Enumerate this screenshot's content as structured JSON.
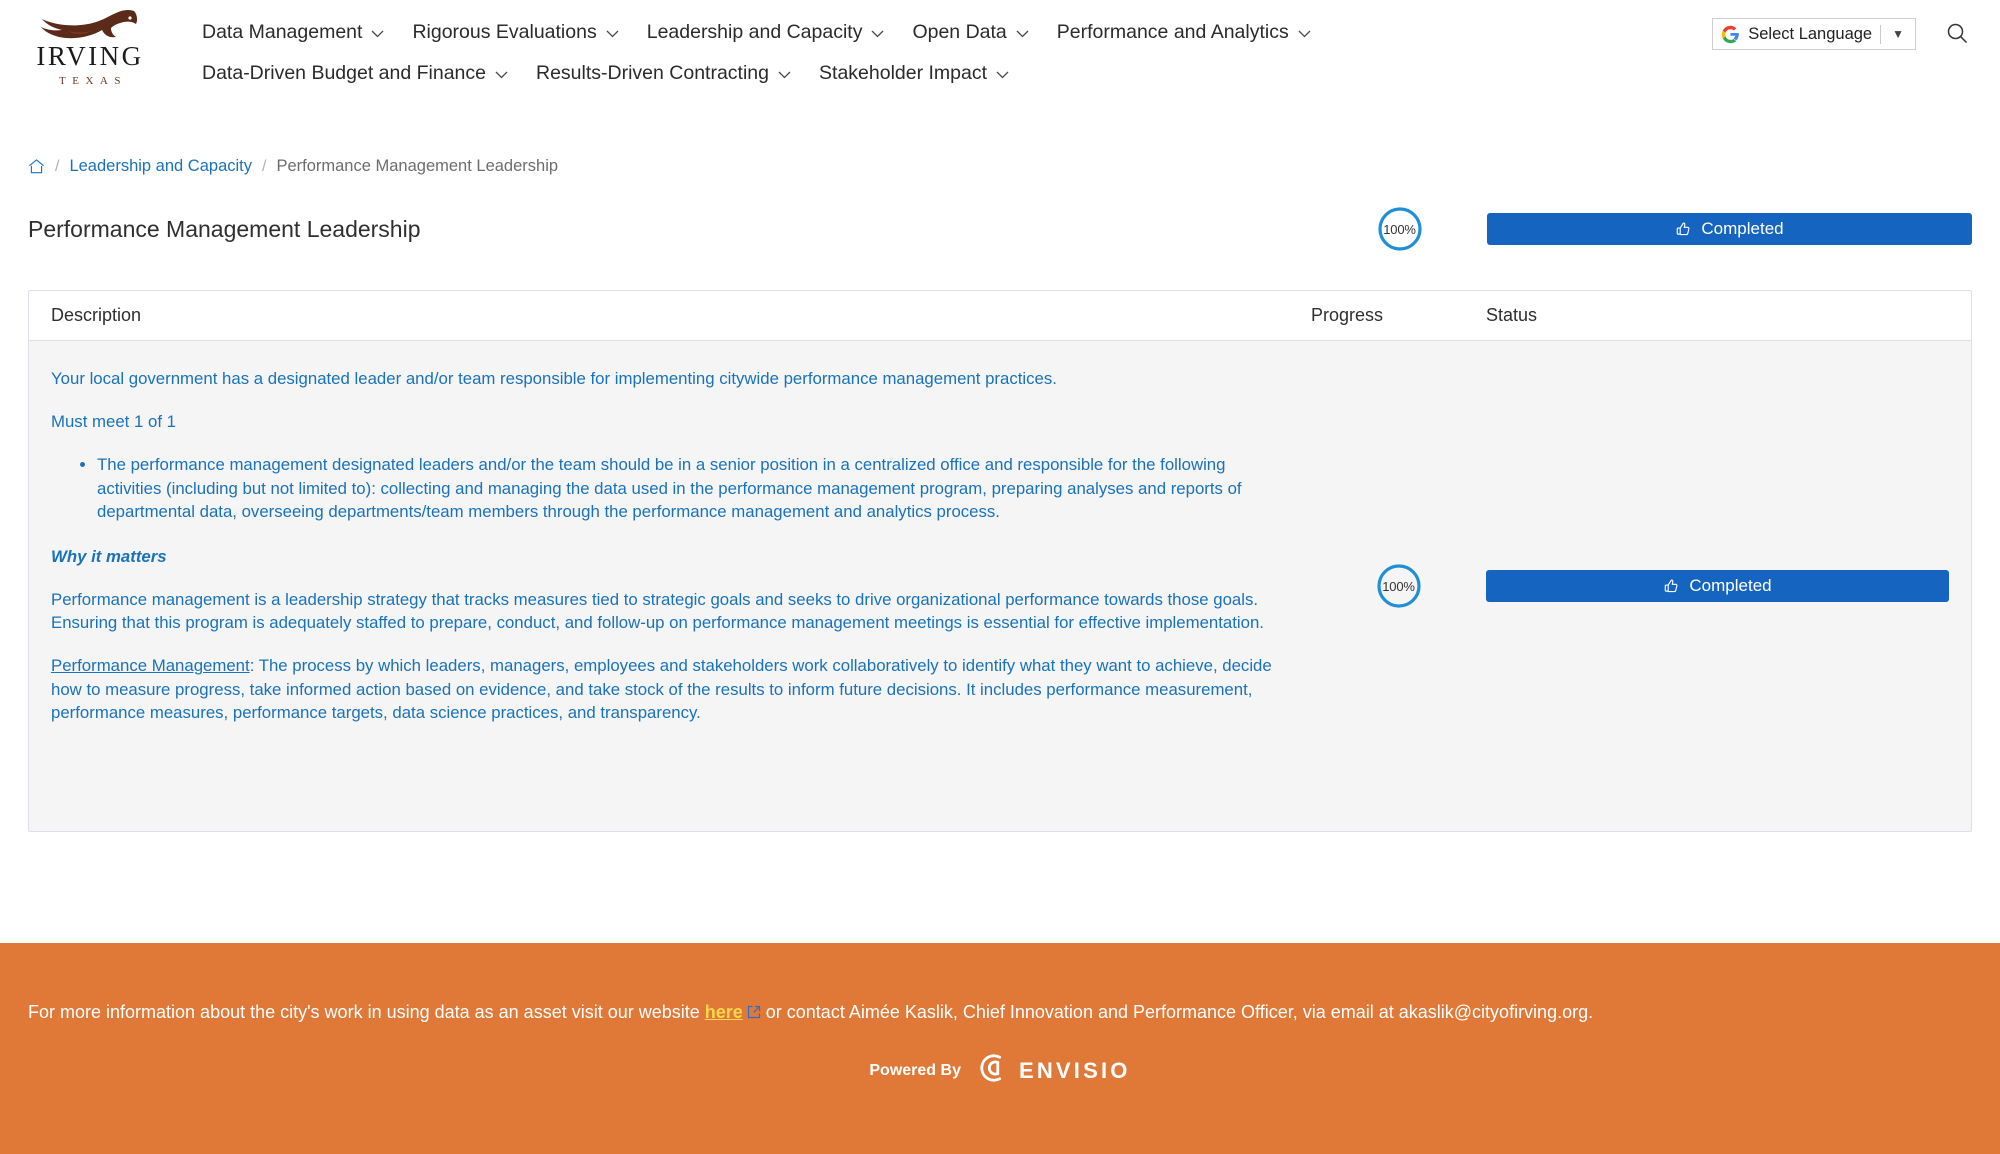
{
  "brand": {
    "name": "IRVING",
    "state": "TEXAS",
    "logo_icon": "horse-head-icon",
    "logo_color": "#5c2a19"
  },
  "nav": {
    "items": [
      {
        "label": "Data Management",
        "caret": "chevron-down-icon"
      },
      {
        "label": "Rigorous Evaluations",
        "caret": "chevron-down-icon"
      },
      {
        "label": "Leadership and Capacity",
        "caret": "chevron-down-icon"
      },
      {
        "label": "Open Data",
        "caret": "chevron-down-icon"
      },
      {
        "label": "Performance and Analytics",
        "caret": "chevron-down-icon"
      },
      {
        "label": "Data-Driven Budget and Finance",
        "caret": "chevron-down-icon"
      },
      {
        "label": "Results-Driven Contracting",
        "caret": "chevron-down-icon"
      },
      {
        "label": "Stakeholder Impact",
        "caret": "chevron-down-icon"
      }
    ]
  },
  "header_right": {
    "translate": {
      "icon": "google-g-icon",
      "label": "Select Language",
      "caret": "▼"
    },
    "search_icon": "search-icon"
  },
  "breadcrumb": {
    "home_icon": "home-icon",
    "separator": "/",
    "link": "Leadership and Capacity",
    "current": "Performance Management Leadership"
  },
  "page": {
    "title": "Performance Management Leadership",
    "progress_percent": "100%",
    "status_label": "Completed",
    "status_icon": "thumbs-up-icon",
    "status_color": "#1565c0",
    "progress_ring_color": "#1f8fd6"
  },
  "table": {
    "headers": {
      "description": "Description",
      "progress": "Progress",
      "status": "Status"
    },
    "row": {
      "intro": "Your local government has a designated leader and/or team responsible for implementing citywide performance management practices.",
      "must_meet": "Must meet 1 of 1",
      "bullets": [
        "The performance management designated leaders and/or the team should be in a senior position in a centralized office and responsible for the following activities (including but not limited to): collecting and managing the data used in the performance management program, preparing analyses and reports of departmental data, overseeing departments/team members through the performance management and analytics process."
      ],
      "why_heading": "Why it matters",
      "why_body": "Performance management is a leadership strategy that tracks measures tied to strategic goals and seeks to drive organizational performance towards those goals. Ensuring that this program is adequately staffed to prepare, conduct, and follow-up on performance management meetings is essential for effective implementation.",
      "definition_term": "Performance Management",
      "definition_body": ": The process by which leaders, managers, employees and stakeholders work collaboratively to identify what they want to achieve, decide how to measure progress, take informed action based on evidence, and take stock of the results to inform future decisions. It includes performance measurement, performance measures, performance targets, data science practices, and transparency.",
      "progress_percent": "100%",
      "status_label": "Completed",
      "status_icon": "thumbs-up-icon"
    }
  },
  "footer": {
    "background": "#e07838",
    "text_before": "For more information about the city's work in using data as an asset visit our website ",
    "link_label": "here",
    "link_icon": "external-link-icon",
    "text_after": " or contact Aimée Kaslik, Chief Innovation and Performance Officer, via email at akaslik@cityofirving.org.",
    "powered_by": "Powered By",
    "vendor": "ENVISIO",
    "vendor_icon": "envisio-mark-icon"
  }
}
